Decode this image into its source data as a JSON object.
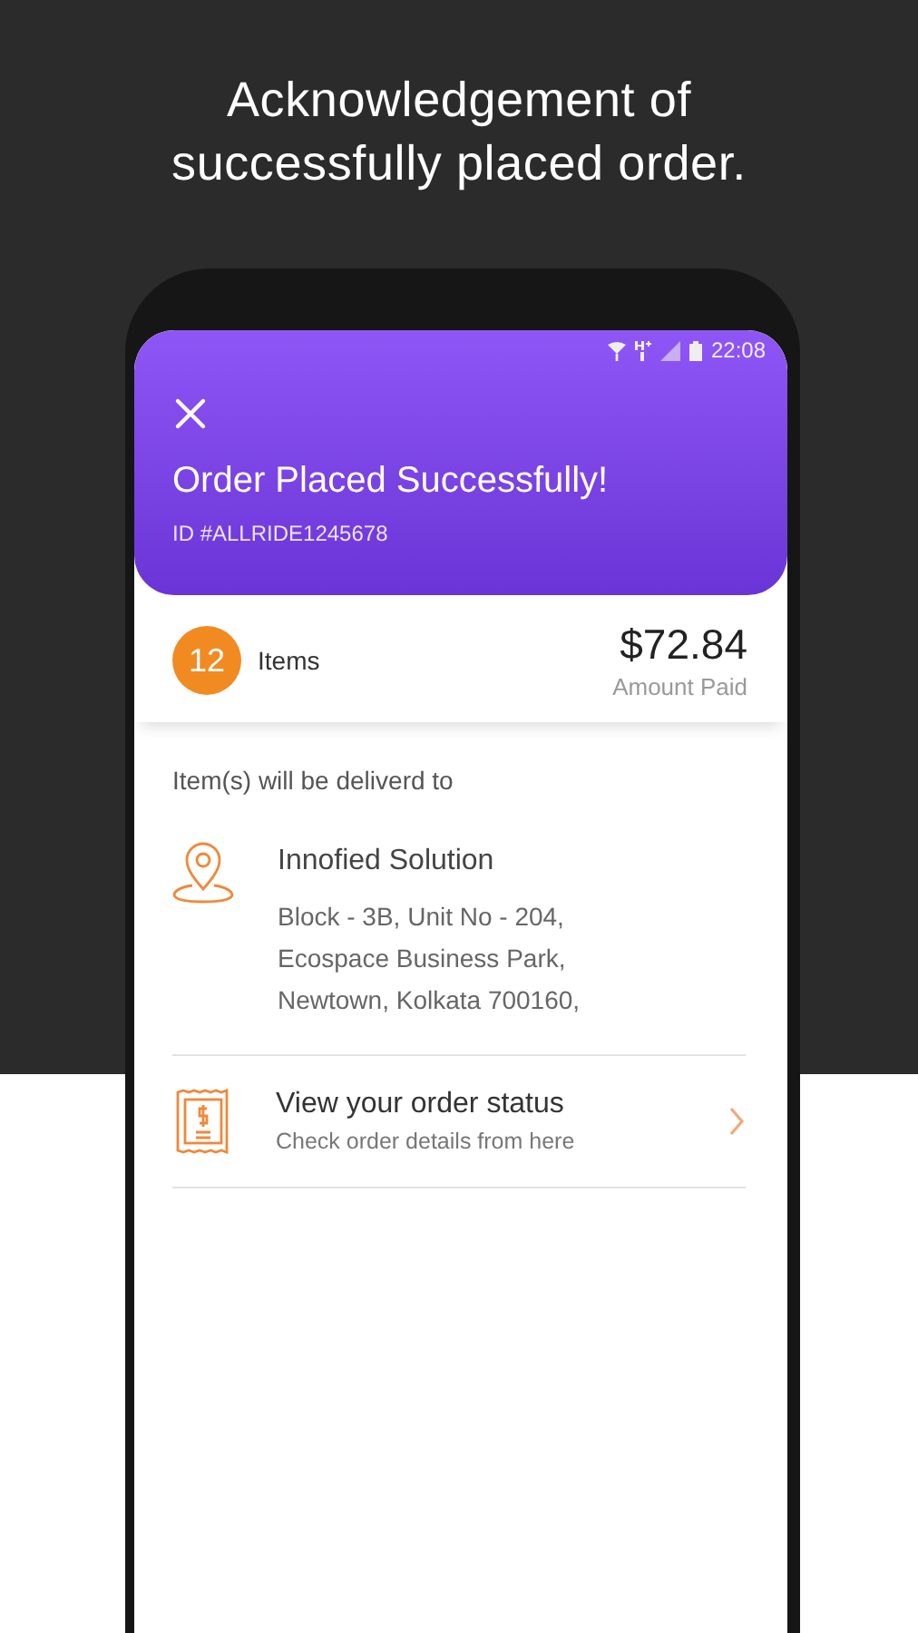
{
  "headline": [
    "Acknowledgement of",
    "successfully placed order."
  ],
  "status_bar": {
    "time": "22:08"
  },
  "header": {
    "title": "Order Placed Successfully!",
    "order_id": "ID #ALLRIDE1245678"
  },
  "summary": {
    "item_count": "12",
    "items_label": "Items",
    "amount": "$72.84",
    "amount_label": "Amount Paid"
  },
  "delivery": {
    "heading": "Item(s) will be deliverd to",
    "name": "Innofied Solution",
    "address_lines": [
      "Block - 3B, Unit No - 204,",
      "Ecospace Business Park,",
      "Newtown, Kolkata 700160,"
    ]
  },
  "order_status": {
    "title": "View your order status",
    "subtitle": "Check order details from here"
  }
}
